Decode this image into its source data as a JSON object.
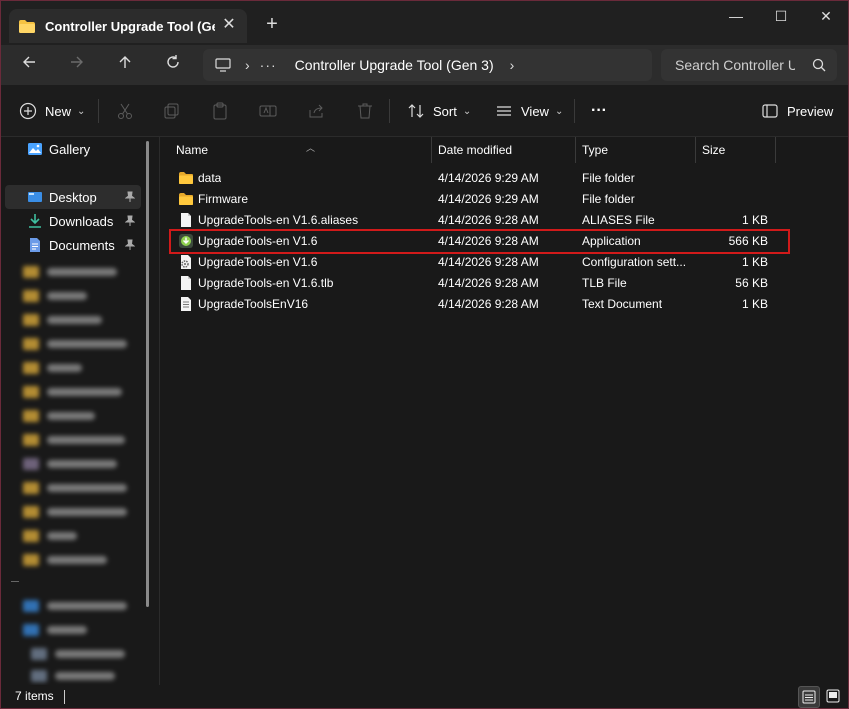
{
  "titlebar": {
    "tab_title": "Controller Upgrade Tool (Gen",
    "close_tab": "✕",
    "new_tab": "+",
    "minimize": "—",
    "maximize": "☐",
    "close": "✕"
  },
  "address": {
    "more": "···",
    "crumb": "Controller Upgrade Tool (Gen 3)",
    "search_placeholder": "Search Controller U"
  },
  "toolbar": {
    "new_label": "New",
    "sort_label": "Sort",
    "view_label": "View",
    "more_label": "···",
    "preview_label": "Preview"
  },
  "sidebar": {
    "gallery": "Gallery",
    "pinned": [
      {
        "label": "Desktop",
        "active": true
      },
      {
        "label": "Downloads",
        "active": false
      },
      {
        "label": "Documents",
        "active": false
      }
    ]
  },
  "columns": {
    "name": "Name",
    "date": "Date modified",
    "type": "Type",
    "size": "Size"
  },
  "files": [
    {
      "name": "data",
      "date": "4/14/2026 9:29 AM",
      "type": "File folder",
      "size": "",
      "icon": "folder-icon"
    },
    {
      "name": "Firmware",
      "date": "4/14/2026 9:29 AM",
      "type": "File folder",
      "size": "",
      "icon": "folder-icon"
    },
    {
      "name": "UpgradeTools-en V1.6.aliases",
      "date": "4/14/2026 9:28 AM",
      "type": "ALIASES File",
      "size": "1 KB",
      "icon": "file-icon"
    },
    {
      "name": "UpgradeTools-en V1.6",
      "date": "4/14/2026 9:28 AM",
      "type": "Application",
      "size": "566 KB",
      "icon": "application-icon"
    },
    {
      "name": "UpgradeTools-en V1.6",
      "date": "4/14/2026 9:28 AM",
      "type": "Configuration sett...",
      "size": "1 KB",
      "icon": "config-file-icon"
    },
    {
      "name": "UpgradeTools-en V1.6.tlb",
      "date": "4/14/2026 9:28 AM",
      "type": "TLB File",
      "size": "56 KB",
      "icon": "file-icon"
    },
    {
      "name": "UpgradeToolsEnV16",
      "date": "4/14/2026 9:28 AM",
      "type": "Text Document",
      "size": "1 KB",
      "icon": "text-file-icon"
    }
  ],
  "status": {
    "items": "7 items"
  },
  "colors": {
    "highlight": "#d11a1a",
    "folder": "#f5c242",
    "accent": "#4aa3ff"
  }
}
